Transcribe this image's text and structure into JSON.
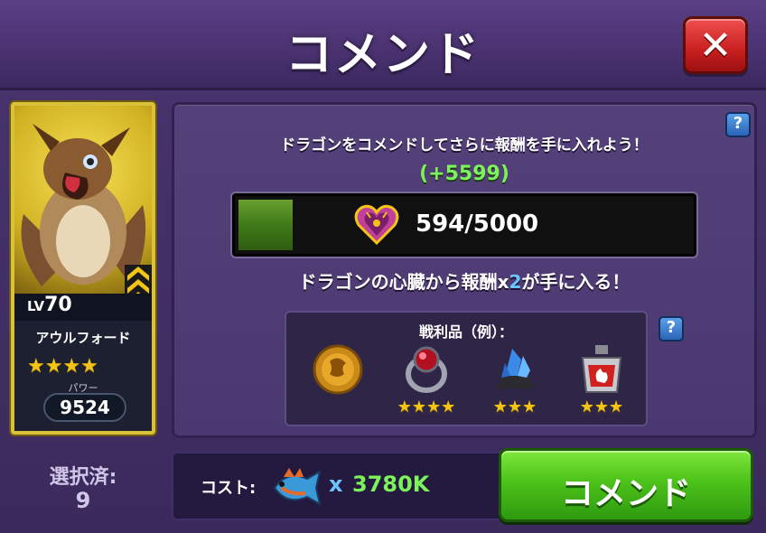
{
  "header": {
    "title": "コメンド",
    "close_label": "✕"
  },
  "hero": {
    "level_prefix": "LV",
    "level": "70",
    "name": "アウルフォード",
    "stars": "★★★★",
    "power_label": "パワー",
    "power": "9524"
  },
  "selection": {
    "label": "選択済:",
    "count": "9"
  },
  "panel": {
    "help_label": "?",
    "description": "ドラゴンをコメンドしてさらに報酬を手に入れよう！",
    "bonus": "(+5599)",
    "progress": {
      "text": "594/5000",
      "current": 594,
      "max": 5000
    },
    "heart_desc_pre": "ドラゴンの心臓から報酬x",
    "heart_desc_mult": "2",
    "heart_desc_post": "が手に入る！"
  },
  "loot": {
    "label": "戦利品（例）：",
    "help_label": "?",
    "items": [
      {
        "icon": "gold-medallion-icon",
        "stars": ""
      },
      {
        "icon": "ruby-ring-icon",
        "stars": "★★★★"
      },
      {
        "icon": "crystal-ore-icon",
        "stars": "★★★"
      },
      {
        "icon": "potion-flask-icon",
        "stars": "★★★"
      }
    ]
  },
  "cost": {
    "label": "コスト:",
    "icon": "fish-icon",
    "multiplier": "x",
    "value": "3780K"
  },
  "command_button": {
    "label": "コメンド"
  },
  "colors": {
    "accent_green": "#7cf35a",
    "accent_blue": "#6cc4ff",
    "star_gold": "#f3c417",
    "close_red": "#c81f1f",
    "button_green": "#4cc21a"
  }
}
